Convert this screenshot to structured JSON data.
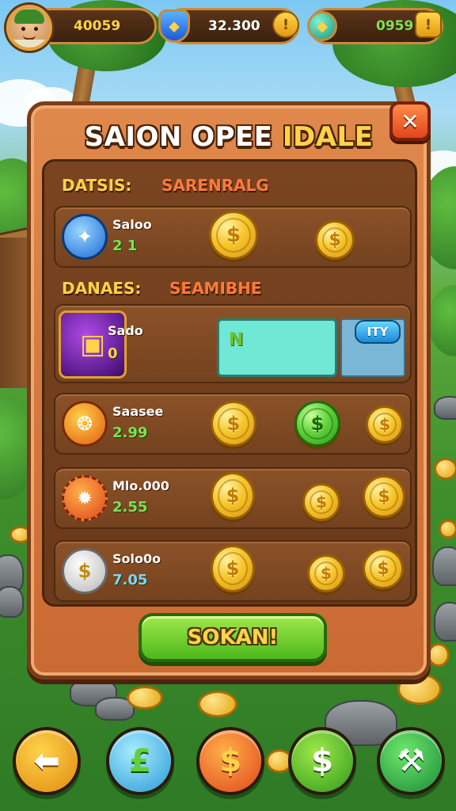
{
  "hud": {
    "gold_value": "40059",
    "gems_value": "32.300",
    "cash_value": "0959",
    "gems_plus": "!",
    "cash_plus": "!"
  },
  "panel": {
    "title_main": "SAION OPEE ",
    "title_accent": "IDALE",
    "close_label": "✕",
    "section1_left": "DATSIS:",
    "section1_right": "SARENRALG",
    "section2_left": "DANAES:",
    "section2_right": "SEAMIBHE",
    "rows": [
      {
        "name": "Saloo",
        "value": "2 1",
        "icon": "blue-swirl-icon"
      },
      {
        "name": "Sado",
        "value": "0",
        "icon": "gold-chest-icon",
        "box_label": "N",
        "button_label": "ITY"
      },
      {
        "name": "Saasee",
        "value": "2.99",
        "icon": "fire-emblem-icon"
      },
      {
        "name": "Mlo.000",
        "value": "2.55",
        "icon": "fire-gear-icon"
      },
      {
        "name": "Solo0o",
        "value": "7.05",
        "icon": "silver-coin-icon"
      }
    ],
    "confirm_label": "SOKAN!"
  },
  "colors": {
    "panel": "#d4773c",
    "panel_border": "#7a3d17",
    "inner": "#6a391a",
    "accent_gold": "#ffd24a",
    "accent_red": "#ff7a3a",
    "value_green": "#7fe05a",
    "value_blue": "#7fd6ff"
  },
  "nav": [
    {
      "icon": "back-arrow-icon"
    },
    {
      "icon": "blue-currency-icon"
    },
    {
      "icon": "orange-dollar-icon"
    },
    {
      "icon": "green-dollar-icon"
    },
    {
      "icon": "green-tool-icon"
    }
  ]
}
